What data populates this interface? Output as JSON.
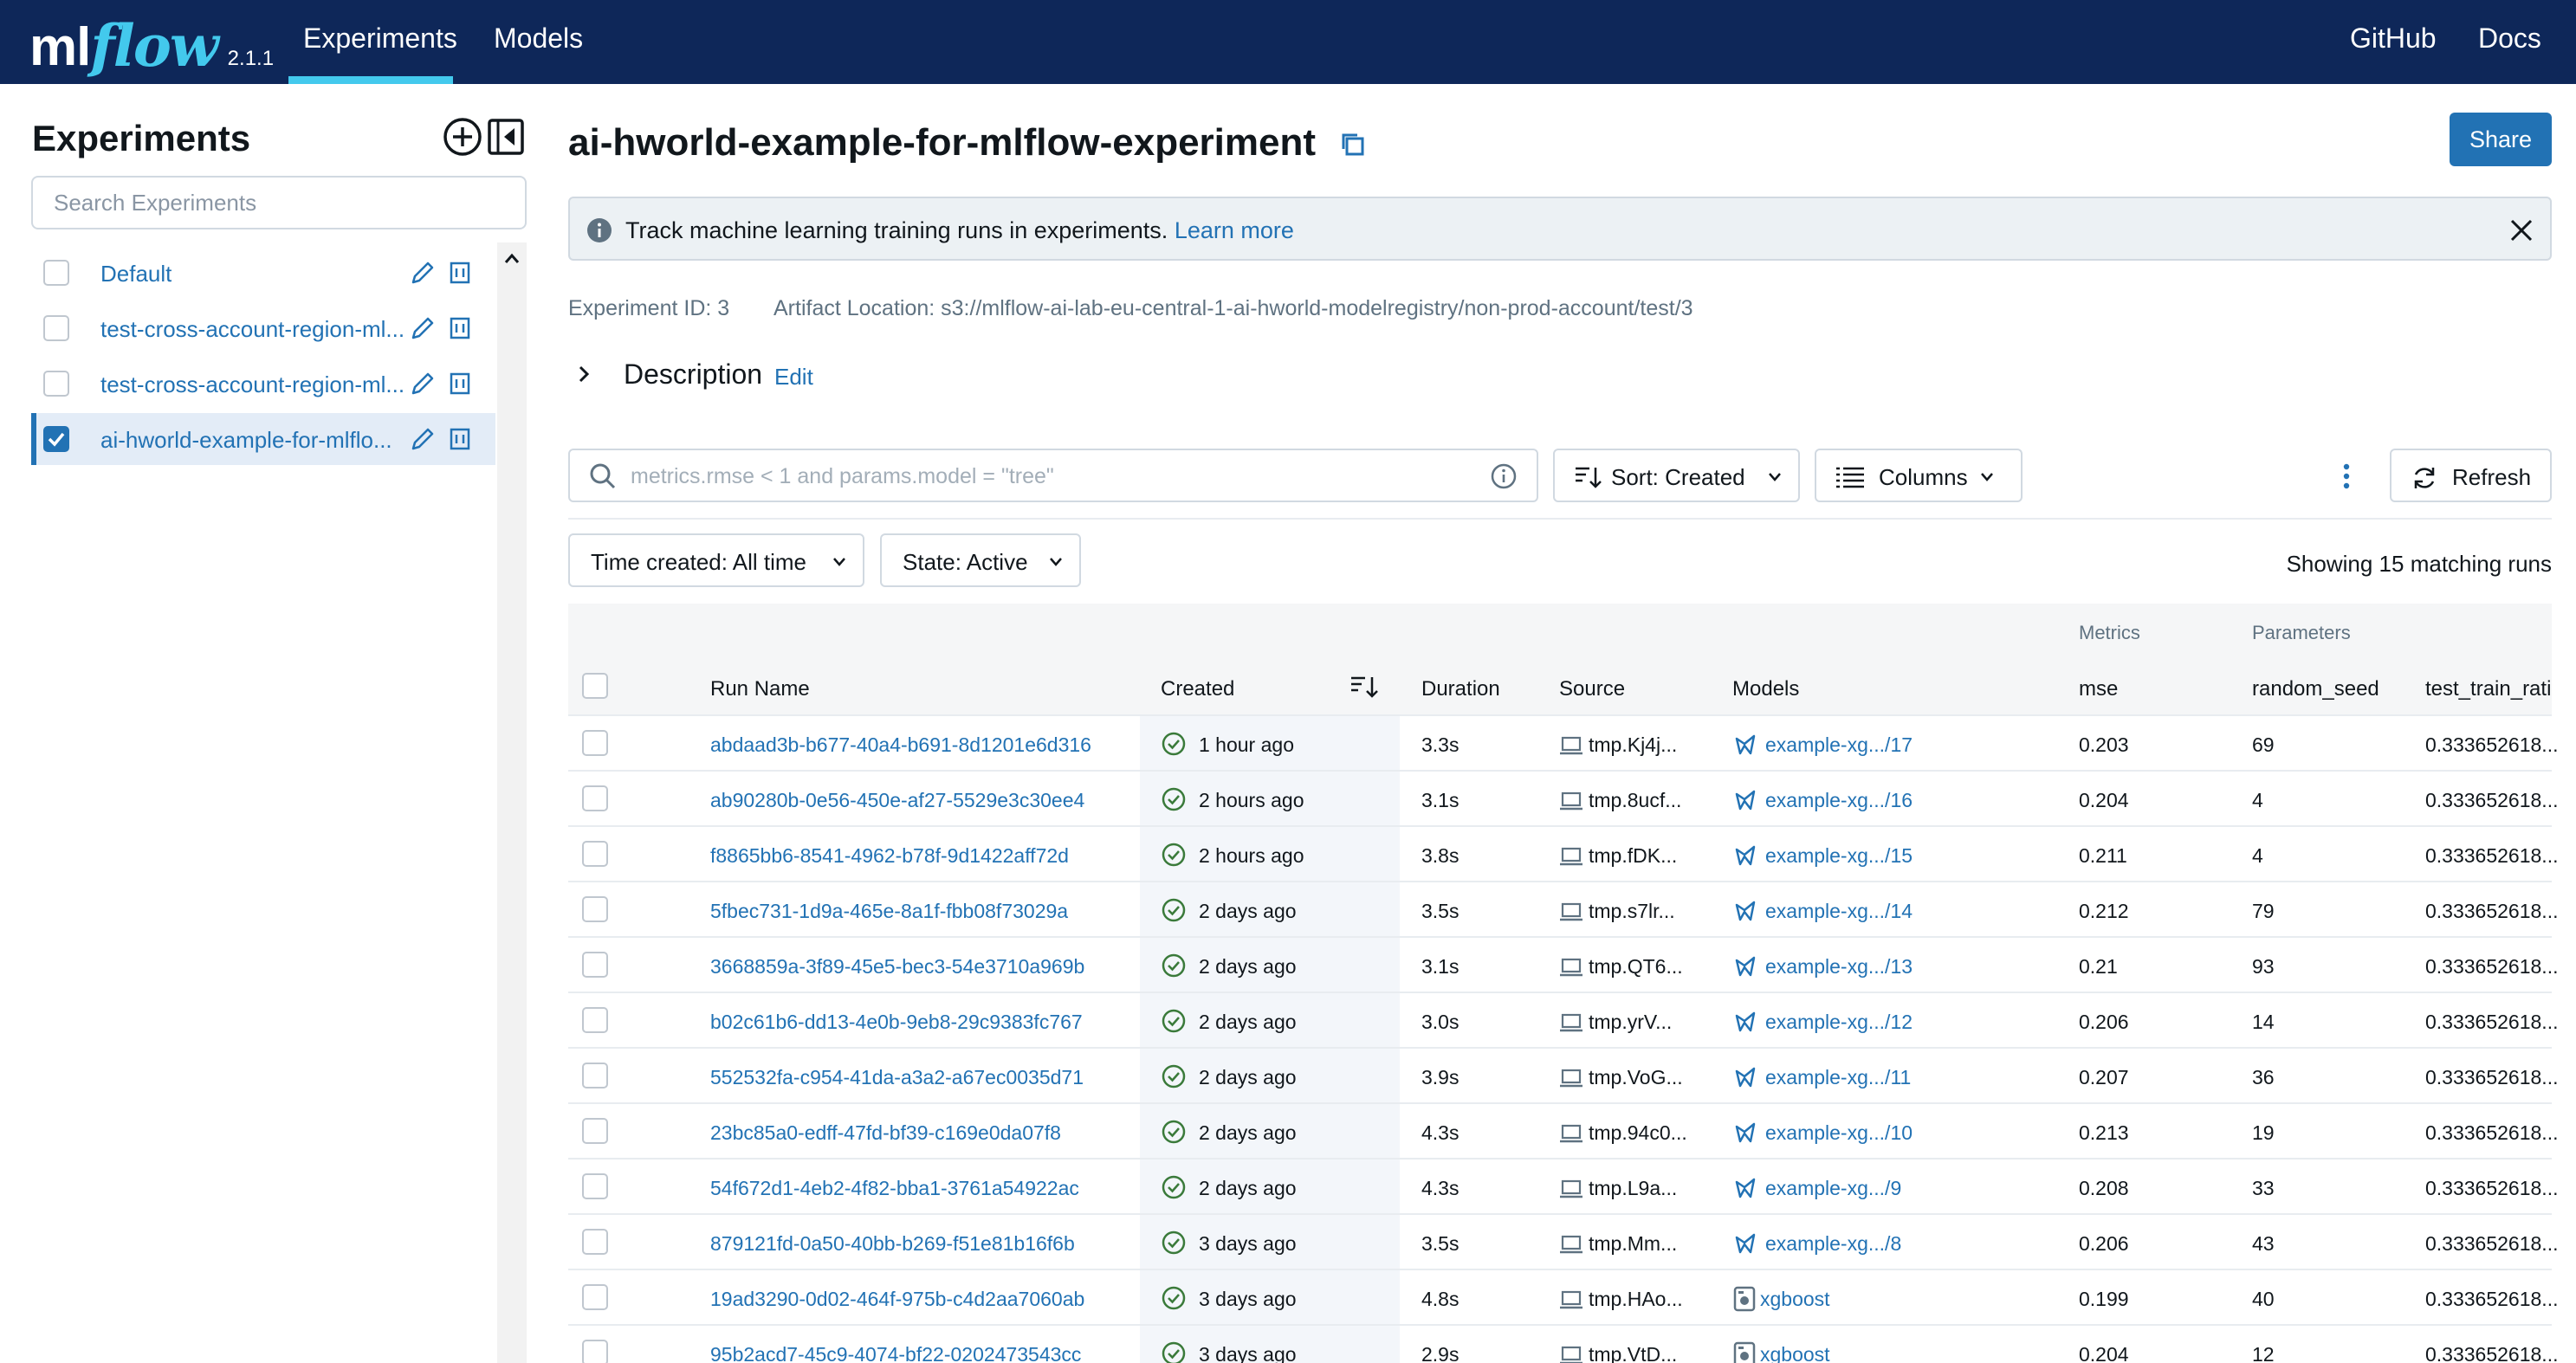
{
  "nav": {
    "logo_ml": "ml",
    "logo_flow": "flow",
    "version": "2.1.1",
    "links": [
      "Experiments",
      "Models"
    ],
    "right_links": [
      "GitHub",
      "Docs"
    ]
  },
  "sidebar": {
    "title": "Experiments",
    "search_placeholder": "Search Experiments",
    "items": [
      {
        "label": "Default",
        "checked": false
      },
      {
        "label": "test-cross-account-region-ml...",
        "checked": false
      },
      {
        "label": "test-cross-account-region-ml...",
        "checked": false
      },
      {
        "label": "ai-hworld-example-for-mlflo...",
        "checked": true
      }
    ]
  },
  "main": {
    "title": "ai-hworld-example-for-mlflow-experiment",
    "share_label": "Share",
    "alert_text": "Track machine learning training runs in experiments.",
    "alert_link": "Learn more",
    "experiment_id": "Experiment ID: 3",
    "artifact_location": "Artifact Location: s3://mlflow-ai-lab-eu-central-1-ai-hworld-modelregistry/non-prod-account/test/3",
    "description_label": "Description",
    "description_edit": "Edit",
    "search_placeholder": "metrics.rmse < 1 and params.model = \"tree\"",
    "sort_label": "Sort: Created",
    "columns_label": "Columns",
    "refresh_label": "Refresh",
    "time_filter": "Time created: All time",
    "state_filter": "State: Active",
    "showing": "Showing 15 matching runs"
  },
  "table": {
    "group_headers": {
      "metrics": "Metrics",
      "parameters": "Parameters"
    },
    "headers": {
      "run_name": "Run Name",
      "created": "Created",
      "duration": "Duration",
      "source": "Source",
      "models": "Models",
      "mse": "mse",
      "random_seed": "random_seed",
      "test_train_ratio": "test_train_ratio"
    },
    "rows": [
      {
        "run": "abdaad3b-b677-40a4-b691-8d1201e6d316",
        "created": "1 hour ago",
        "duration": "3.3s",
        "source": "tmp.Kj4j...",
        "model": "example-xg.../17",
        "model_type": "registered",
        "mse": "0.203",
        "seed": "69",
        "ratio": "0.333652618..."
      },
      {
        "run": "ab90280b-0e56-450e-af27-5529e3c30ee4",
        "created": "2 hours ago",
        "duration": "3.1s",
        "source": "tmp.8ucf...",
        "model": "example-xg.../16",
        "model_type": "registered",
        "mse": "0.204",
        "seed": "4",
        "ratio": "0.333652618..."
      },
      {
        "run": "f8865bb6-8541-4962-b78f-9d1422aff72d",
        "created": "2 hours ago",
        "duration": "3.8s",
        "source": "tmp.fDK...",
        "model": "example-xg.../15",
        "model_type": "registered",
        "mse": "0.211",
        "seed": "4",
        "ratio": "0.333652618..."
      },
      {
        "run": "5fbec731-1d9a-465e-8a1f-fbb08f73029a",
        "created": "2 days ago",
        "duration": "3.5s",
        "source": "tmp.s7lr...",
        "model": "example-xg.../14",
        "model_type": "registered",
        "mse": "0.212",
        "seed": "79",
        "ratio": "0.333652618..."
      },
      {
        "run": "3668859a-3f89-45e5-bec3-54e3710a969b",
        "created": "2 days ago",
        "duration": "3.1s",
        "source": "tmp.QT6...",
        "model": "example-xg.../13",
        "model_type": "registered",
        "mse": "0.21",
        "seed": "93",
        "ratio": "0.333652618..."
      },
      {
        "run": "b02c61b6-dd13-4e0b-9eb8-29c9383fc767",
        "created": "2 days ago",
        "duration": "3.0s",
        "source": "tmp.yrV...",
        "model": "example-xg.../12",
        "model_type": "registered",
        "mse": "0.206",
        "seed": "14",
        "ratio": "0.333652618..."
      },
      {
        "run": "552532fa-c954-41da-a3a2-a67ec0035d71",
        "created": "2 days ago",
        "duration": "3.9s",
        "source": "tmp.VoG...",
        "model": "example-xg.../11",
        "model_type": "registered",
        "mse": "0.207",
        "seed": "36",
        "ratio": "0.333652618..."
      },
      {
        "run": "23bc85a0-edff-47fd-bf39-c169e0da07f8",
        "created": "2 days ago",
        "duration": "4.3s",
        "source": "tmp.94c0...",
        "model": "example-xg.../10",
        "model_type": "registered",
        "mse": "0.213",
        "seed": "19",
        "ratio": "0.333652618..."
      },
      {
        "run": "54f672d1-4eb2-4f82-bba1-3761a54922ac",
        "created": "2 days ago",
        "duration": "4.3s",
        "source": "tmp.L9a...",
        "model": "example-xg.../9",
        "model_type": "registered",
        "mse": "0.208",
        "seed": "33",
        "ratio": "0.333652618..."
      },
      {
        "run": "879121fd-0a50-40bb-b269-f51e81b16f6b",
        "created": "3 days ago",
        "duration": "3.5s",
        "source": "tmp.Mm...",
        "model": "example-xg.../8",
        "model_type": "registered",
        "mse": "0.206",
        "seed": "43",
        "ratio": "0.333652618..."
      },
      {
        "run": "19ad3290-0d02-464f-975b-c4d2aa7060ab",
        "created": "3 days ago",
        "duration": "4.8s",
        "source": "tmp.HAo...",
        "model": "xgboost",
        "model_type": "logged",
        "mse": "0.199",
        "seed": "40",
        "ratio": "0.333652618..."
      },
      {
        "run": "95b2acd7-45c9-4074-bf22-0202473543cc",
        "created": "3 days ago",
        "duration": "2.9s",
        "source": "tmp.VtD...",
        "model": "xgboost",
        "model_type": "logged",
        "mse": "0.204",
        "seed": "12",
        "ratio": "0.333652618..."
      }
    ]
  },
  "colors": {
    "nav_bg": "#0e2759",
    "accent": "#43c9ed",
    "primary": "#2272b4",
    "success": "#3a7a3a"
  }
}
